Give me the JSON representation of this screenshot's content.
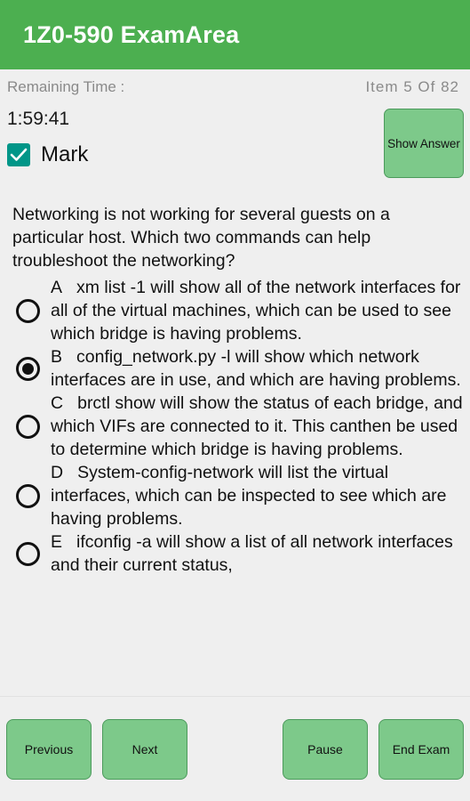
{
  "appbar": {
    "title": "1Z0-590 ExamArea"
  },
  "status": {
    "remaining_time_label": "Remaining Time :",
    "item_counter": "Item 5 Of 82",
    "timer_value": "1:59:41",
    "mark_label": "Mark",
    "mark_checked": true,
    "show_answer_label": "Show Answer"
  },
  "question": {
    "text": "Networking is not working for several guests on a particular host. Which two commands can help troubleshoot the networking?",
    "options": [
      {
        "letter": "A",
        "text": "xm list -1 will show all of the network interfaces for all of the virtual machines, which can be used to see which bridge is having problems.",
        "selected": false
      },
      {
        "letter": "B",
        "text": "config_network.py -l will show which network interfaces are in use, and which are having problems.",
        "selected": true
      },
      {
        "letter": "C",
        "text": "brctl show will show the status of each bridge, and which VIFs are connected to it. This canthen be used to determine which bridge is having problems.",
        "selected": false
      },
      {
        "letter": "D",
        "text": "System-config-network will list the virtual interfaces, which can be inspected to see which are having problems.",
        "selected": false
      },
      {
        "letter": "E",
        "text": "ifconfig -a will show a list of all network interfaces and their current status,",
        "selected": false
      }
    ]
  },
  "footer": {
    "previous_label": "Previous",
    "next_label": "Next",
    "pause_label": "Pause",
    "end_exam_label": "End Exam"
  },
  "colors": {
    "appbar_green": "#4caf50",
    "button_green": "#7dc98a",
    "button_border_green": "#4c9a5c",
    "checkbox_teal": "#009688",
    "page_background": "#efefef"
  }
}
